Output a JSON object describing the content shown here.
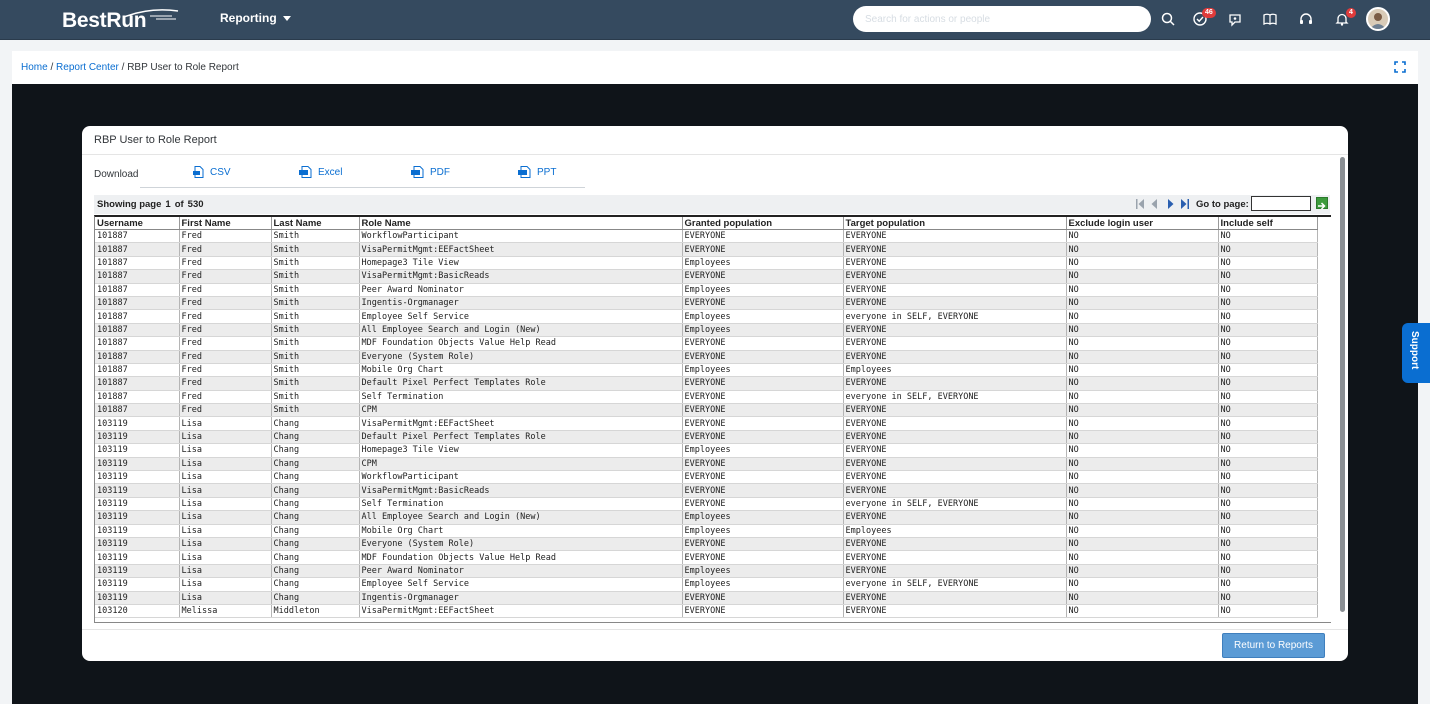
{
  "header": {
    "logo_prefix": "Best",
    "logo_suffix": "Run",
    "module": "Reporting",
    "search_placeholder": "Search for actions or people",
    "badges": {
      "todo": "46",
      "notifications": "4"
    }
  },
  "breadcrumb": {
    "home": "Home",
    "sep1": " / ",
    "report_center": "Report Center",
    "sep2": " / ",
    "current": "RBP User to Role Report"
  },
  "report": {
    "title": "RBP User to Role Report",
    "download_label": "Download",
    "downloads": {
      "csv": "CSV",
      "excel": "Excel",
      "pdf": "PDF",
      "ppt": "PPT"
    },
    "pager": {
      "showing_label": "Showing page",
      "page": "1",
      "of_label": "of",
      "total": "530",
      "goto_label": "Go to page:"
    },
    "columns": [
      "Username",
      "First Name",
      "Last Name",
      "Role Name",
      "Granted population",
      "Target population",
      "Exclude login user",
      "Include self"
    ],
    "rows": [
      [
        "101887",
        "Fred",
        "Smith",
        "WorkflowParticipant",
        "EVERYONE",
        "EVERYONE",
        "NO",
        "NO"
      ],
      [
        "101887",
        "Fred",
        "Smith",
        "VisaPermitMgmt:EEFactSheet",
        "EVERYONE",
        "EVERYONE",
        "NO",
        "NO"
      ],
      [
        "101887",
        "Fred",
        "Smith",
        "Homepage3 Tile View",
        "Employees",
        "EVERYONE",
        "NO",
        "NO"
      ],
      [
        "101887",
        "Fred",
        "Smith",
        "VisaPermitMgmt:BasicReads",
        "EVERYONE",
        "EVERYONE",
        "NO",
        "NO"
      ],
      [
        "101887",
        "Fred",
        "Smith",
        "Peer Award Nominator",
        "Employees",
        "EVERYONE",
        "NO",
        "NO"
      ],
      [
        "101887",
        "Fred",
        "Smith",
        "Ingentis-Orgmanager",
        "EVERYONE",
        "EVERYONE",
        "NO",
        "NO"
      ],
      [
        "101887",
        "Fred",
        "Smith",
        "Employee Self Service",
        "Employees",
        "everyone in SELF, EVERYONE",
        "NO",
        "NO"
      ],
      [
        "101887",
        "Fred",
        "Smith",
        "All Employee Search and Login (New)",
        "Employees",
        "EVERYONE",
        "NO",
        "NO"
      ],
      [
        "101887",
        "Fred",
        "Smith",
        "MDF Foundation Objects Value Help Read",
        "EVERYONE",
        "EVERYONE",
        "NO",
        "NO"
      ],
      [
        "101887",
        "Fred",
        "Smith",
        "Everyone (System Role)",
        "EVERYONE",
        "EVERYONE",
        "NO",
        "NO"
      ],
      [
        "101887",
        "Fred",
        "Smith",
        "Mobile Org Chart",
        "Employees",
        "Employees",
        "NO",
        "NO"
      ],
      [
        "101887",
        "Fred",
        "Smith",
        "Default Pixel Perfect Templates Role",
        "EVERYONE",
        "EVERYONE",
        "NO",
        "NO"
      ],
      [
        "101887",
        "Fred",
        "Smith",
        "Self Termination",
        "EVERYONE",
        "everyone in SELF, EVERYONE",
        "NO",
        "NO"
      ],
      [
        "101887",
        "Fred",
        "Smith",
        "CPM",
        "EVERYONE",
        "EVERYONE",
        "NO",
        "NO"
      ],
      [
        "103119",
        "Lisa",
        "Chang",
        "VisaPermitMgmt:EEFactSheet",
        "EVERYONE",
        "EVERYONE",
        "NO",
        "NO"
      ],
      [
        "103119",
        "Lisa",
        "Chang",
        "Default Pixel Perfect Templates Role",
        "EVERYONE",
        "EVERYONE",
        "NO",
        "NO"
      ],
      [
        "103119",
        "Lisa",
        "Chang",
        "Homepage3 Tile View",
        "Employees",
        "EVERYONE",
        "NO",
        "NO"
      ],
      [
        "103119",
        "Lisa",
        "Chang",
        "CPM",
        "EVERYONE",
        "EVERYONE",
        "NO",
        "NO"
      ],
      [
        "103119",
        "Lisa",
        "Chang",
        "WorkflowParticipant",
        "EVERYONE",
        "EVERYONE",
        "NO",
        "NO"
      ],
      [
        "103119",
        "Lisa",
        "Chang",
        "VisaPermitMgmt:BasicReads",
        "EVERYONE",
        "EVERYONE",
        "NO",
        "NO"
      ],
      [
        "103119",
        "Lisa",
        "Chang",
        "Self Termination",
        "EVERYONE",
        "everyone in SELF, EVERYONE",
        "NO",
        "NO"
      ],
      [
        "103119",
        "Lisa",
        "Chang",
        "All Employee Search and Login (New)",
        "Employees",
        "EVERYONE",
        "NO",
        "NO"
      ],
      [
        "103119",
        "Lisa",
        "Chang",
        "Mobile Org Chart",
        "Employees",
        "Employees",
        "NO",
        "NO"
      ],
      [
        "103119",
        "Lisa",
        "Chang",
        "Everyone (System Role)",
        "EVERYONE",
        "EVERYONE",
        "NO",
        "NO"
      ],
      [
        "103119",
        "Lisa",
        "Chang",
        "MDF Foundation Objects Value Help Read",
        "EVERYONE",
        "EVERYONE",
        "NO",
        "NO"
      ],
      [
        "103119",
        "Lisa",
        "Chang",
        "Peer Award Nominator",
        "Employees",
        "EVERYONE",
        "NO",
        "NO"
      ],
      [
        "103119",
        "Lisa",
        "Chang",
        "Employee Self Service",
        "Employees",
        "everyone in SELF, EVERYONE",
        "NO",
        "NO"
      ],
      [
        "103119",
        "Lisa",
        "Chang",
        "Ingentis-Orgmanager",
        "EVERYONE",
        "EVERYONE",
        "NO",
        "NO"
      ],
      [
        "103120",
        "Melissa",
        "Middleton",
        "VisaPermitMgmt:EEFactSheet",
        "EVERYONE",
        "EVERYONE",
        "NO",
        "NO"
      ]
    ],
    "return_button": "Return to Reports"
  },
  "support_tab": "Support",
  "colors": {
    "header_bg": "#354a5f",
    "link": "#0a6ed1",
    "button": "#5b9bd5",
    "badge": "#e03b3b"
  }
}
